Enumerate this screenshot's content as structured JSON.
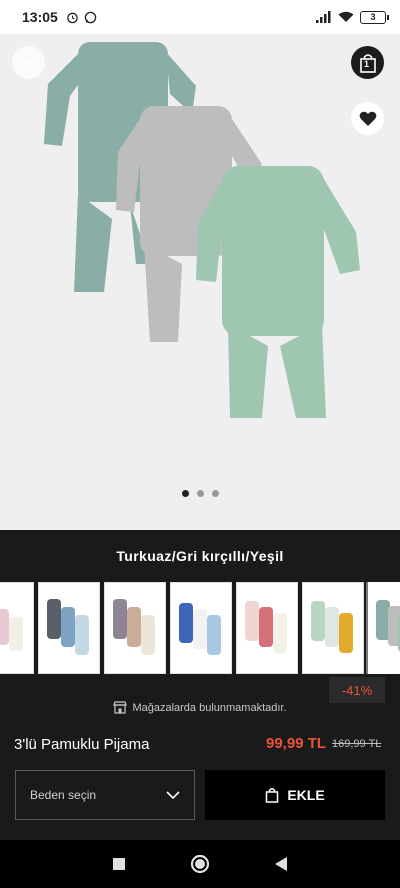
{
  "status_bar": {
    "time": "13:05",
    "battery": "3",
    "icons_left": [
      "alarm-icon",
      "whatsapp-icon"
    ],
    "icons_right": [
      "signal-icon",
      "wifi-icon",
      "battery-icon"
    ]
  },
  "header": {
    "bag_count": "1",
    "icons": [
      "back-arrow-icon",
      "shopping-bag-icon",
      "heart-icon"
    ]
  },
  "gallery": {
    "page_count": 3,
    "active_index": 0
  },
  "product": {
    "color_name": "Turkuaz/Gri kırçıllı/Yeşil",
    "discount": "-41%",
    "store_note": "Mağazalarda bulunmamaktadır.",
    "title": "3'lü Pamuklu Pijama",
    "price_sale": "99,99 TL",
    "price_old": "169,99 TL"
  },
  "swatches": {
    "count": 7,
    "selected_index": 6
  },
  "actions": {
    "size_label": "Beden seçin",
    "add_label": "EKLE"
  },
  "colors": {
    "background": "#1a1a1a",
    "accent": "#e8533a",
    "button": "#000000",
    "image_bg": "#efeff0"
  },
  "nav": {
    "icons": [
      "recent-apps-icon",
      "home-icon",
      "back-icon"
    ]
  }
}
